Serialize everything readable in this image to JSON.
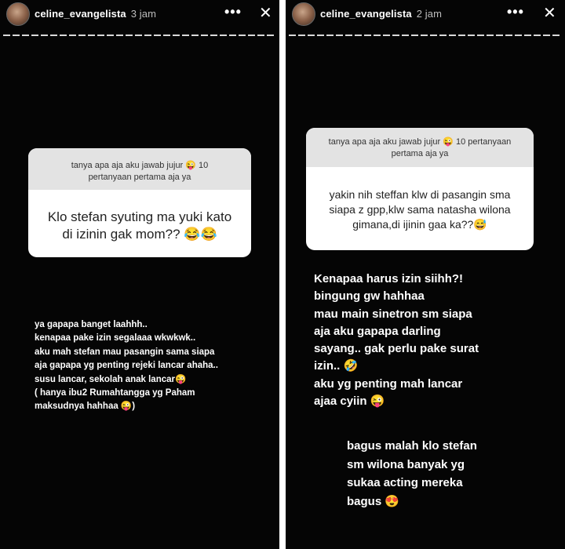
{
  "left": {
    "username": "celine_evangelista",
    "time": "3 jam",
    "question_header": "tanya apa aja aku jawab jujur 😜 10 pertanyaan pertama aja ya",
    "question": "Klo stefan syuting ma yuki kato di izinin gak mom?? 😂😂",
    "answer": "ya gapapa banget laahhh..\nkenapaa pake izin segalaaa wkwkwk..\naku mah stefan mau pasangin sama siapa\naja gapapa yg penting rejeki lancar ahaha..\nsusu lancar, sekolah anak lancar😜\n( hanya ibu2 Rumahtangga yg Paham\nmaksudnya hahhaa 😜)"
  },
  "right": {
    "username": "celine_evangelista",
    "time": "2 jam",
    "question_header": "tanya apa aja aku jawab jujur 😜 10 pertanyaan pertama aja ya",
    "question": "yakin nih steffan klw di pasangin sma siapa z gpp,klw sama natasha wilona gimana,di ijinin gaa ka??😅",
    "answer1": "Kenapaa harus izin siihh?!\nbingung gw hahhaa\nmau main sinetron sm siapa\naja aku gapapa darling\nsayang.. gak perlu pake surat\nizin.. 🤣\naku yg penting mah lancar\najaa cyiin 😜",
    "answer2": "bagus malah klo stefan\nsm wilona banyak yg\nsukaa acting mereka\nbagus 😍"
  },
  "icons": {
    "more": "more-options-icon",
    "close": "close-icon"
  }
}
